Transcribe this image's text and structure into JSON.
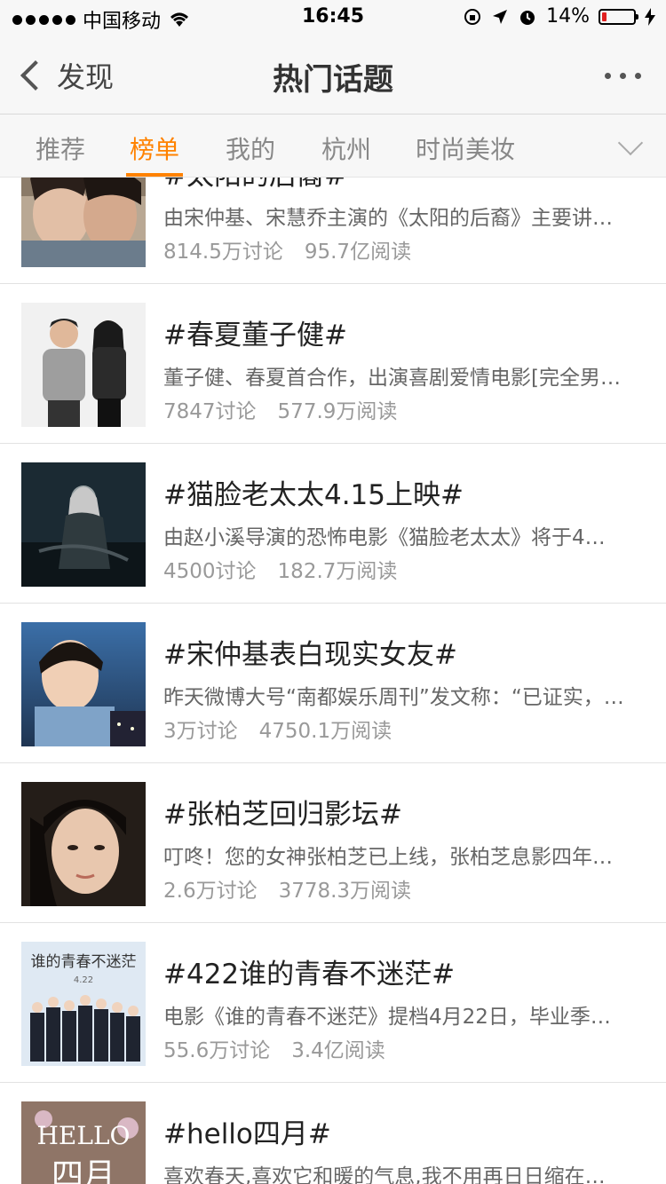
{
  "status_bar": {
    "carrier": "中国移动",
    "time": "16:45",
    "battery": "14%",
    "battery_level": 0.14
  },
  "nav": {
    "back_label": "发现",
    "title": "热门话题"
  },
  "tabs": [
    {
      "label": "推荐",
      "active": false
    },
    {
      "label": "榜单",
      "active": true
    },
    {
      "label": "我的",
      "active": false
    },
    {
      "label": "杭州",
      "active": false
    },
    {
      "label": "时尚美妆",
      "active": false
    }
  ],
  "topics": [
    {
      "title": "#太阳的后裔#",
      "desc": "由宋仲基、宋慧乔主演的《太阳的后裔》主要讲…",
      "discussions": "814.5万讨论",
      "reads": "95.7亿阅读"
    },
    {
      "title": "#春夏董子健#",
      "desc": "董子健、春夏首合作，出演喜剧爱情电影[完全男…",
      "discussions": "7847讨论",
      "reads": "577.9万阅读"
    },
    {
      "title": "#猫脸老太太4.15上映#",
      "desc": "由赵小溪导演的恐怖电影《猫脸老太太》将于4…",
      "discussions": "4500讨论",
      "reads": "182.7万阅读"
    },
    {
      "title": "#宋仲基表白现实女友#",
      "desc": "昨天微博大号“南都娱乐周刊”发文称：“已证实，…",
      "discussions": "3万讨论",
      "reads": "4750.1万阅读"
    },
    {
      "title": "#张柏芝回归影坛#",
      "desc": "叮咚！您的女神张柏芝已上线，张柏芝息影四年…",
      "discussions": "2.6万讨论",
      "reads": "3778.3万阅读"
    },
    {
      "title": "#422谁的青春不迷茫#",
      "desc": "电影《谁的青春不迷茫》提档4月22日，毕业季…",
      "discussions": "55.6万讨论",
      "reads": "3.4亿阅读"
    },
    {
      "title": "#hello四月#",
      "desc": "喜欢春天,喜欢它和暖的气息,我不用再日日缩在…",
      "discussions": "",
      "reads": ""
    }
  ],
  "poster_texts": {
    "qingchun": "谁的青春不迷茫",
    "qingchun_date": "4.22",
    "hello": "HELLO",
    "siyue": "四月"
  },
  "colors": {
    "accent": "#ff8200",
    "bar_bg": "#f7f7f7",
    "battery_low": "#e02020"
  }
}
